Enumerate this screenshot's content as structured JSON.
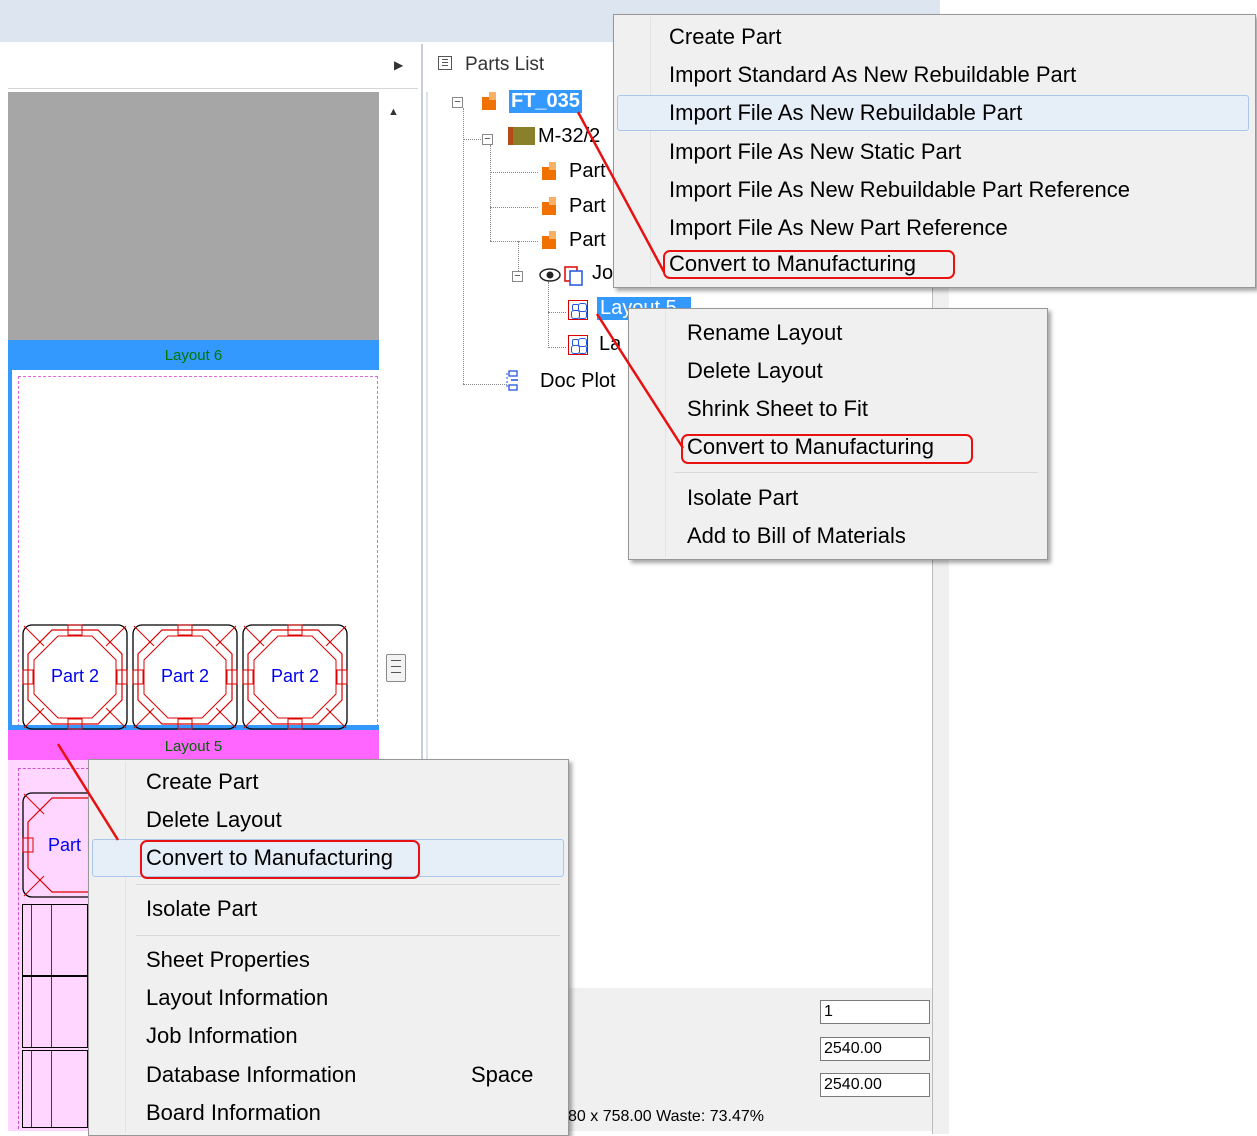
{
  "left_panel": {
    "layout6_title": "Layout 6",
    "layout5_title": "Layout 5",
    "part_labels": [
      "Part 2",
      "Part 2",
      "Part 2"
    ],
    "layout5_part_label": "Part"
  },
  "parts_list": {
    "title": "Parts List",
    "tree": {
      "root": "FT_035",
      "assembly": "M-32/2",
      "parts": [
        "Part",
        "Part",
        "Part"
      ],
      "job": "Jo",
      "layout_selected": "Layout 5",
      "layout_other": "La",
      "doc_plot": "Doc Plot"
    }
  },
  "properties": {
    "colon_label": ":",
    "values": [
      "1",
      "2540.00",
      "2540.00"
    ],
    "footer": "80 x 758.00   Waste: 73.47%"
  },
  "menu_top": {
    "items": [
      "Create Part",
      "Import Standard As New Rebuildable Part",
      "Import File As New Rebuildable Part",
      "Import File As New Static Part",
      "Import File As New Rebuildable Part Reference",
      "Import File As New Part Reference",
      "Convert to Manufacturing"
    ]
  },
  "menu_layout": {
    "items": [
      "Rename Layout",
      "Delete Layout",
      "Shrink Sheet to Fit",
      "Convert to Manufacturing",
      "Isolate Part",
      "Add to Bill of Materials"
    ]
  },
  "menu_sheet": {
    "items": [
      "Create Part",
      "Delete Layout",
      "Convert to Manufacturing",
      "Isolate Part",
      "Sheet Properties",
      "Layout Information",
      "Job Information",
      "Database Information",
      "Board Information"
    ],
    "shortcut_database": "Space"
  },
  "colors": {
    "layout6_header": "#3399ff",
    "layout5_header": "#ff66ff",
    "selection": "#3399ff",
    "annotation_red": "#e81010",
    "menu_background": "#f0f0f0"
  }
}
